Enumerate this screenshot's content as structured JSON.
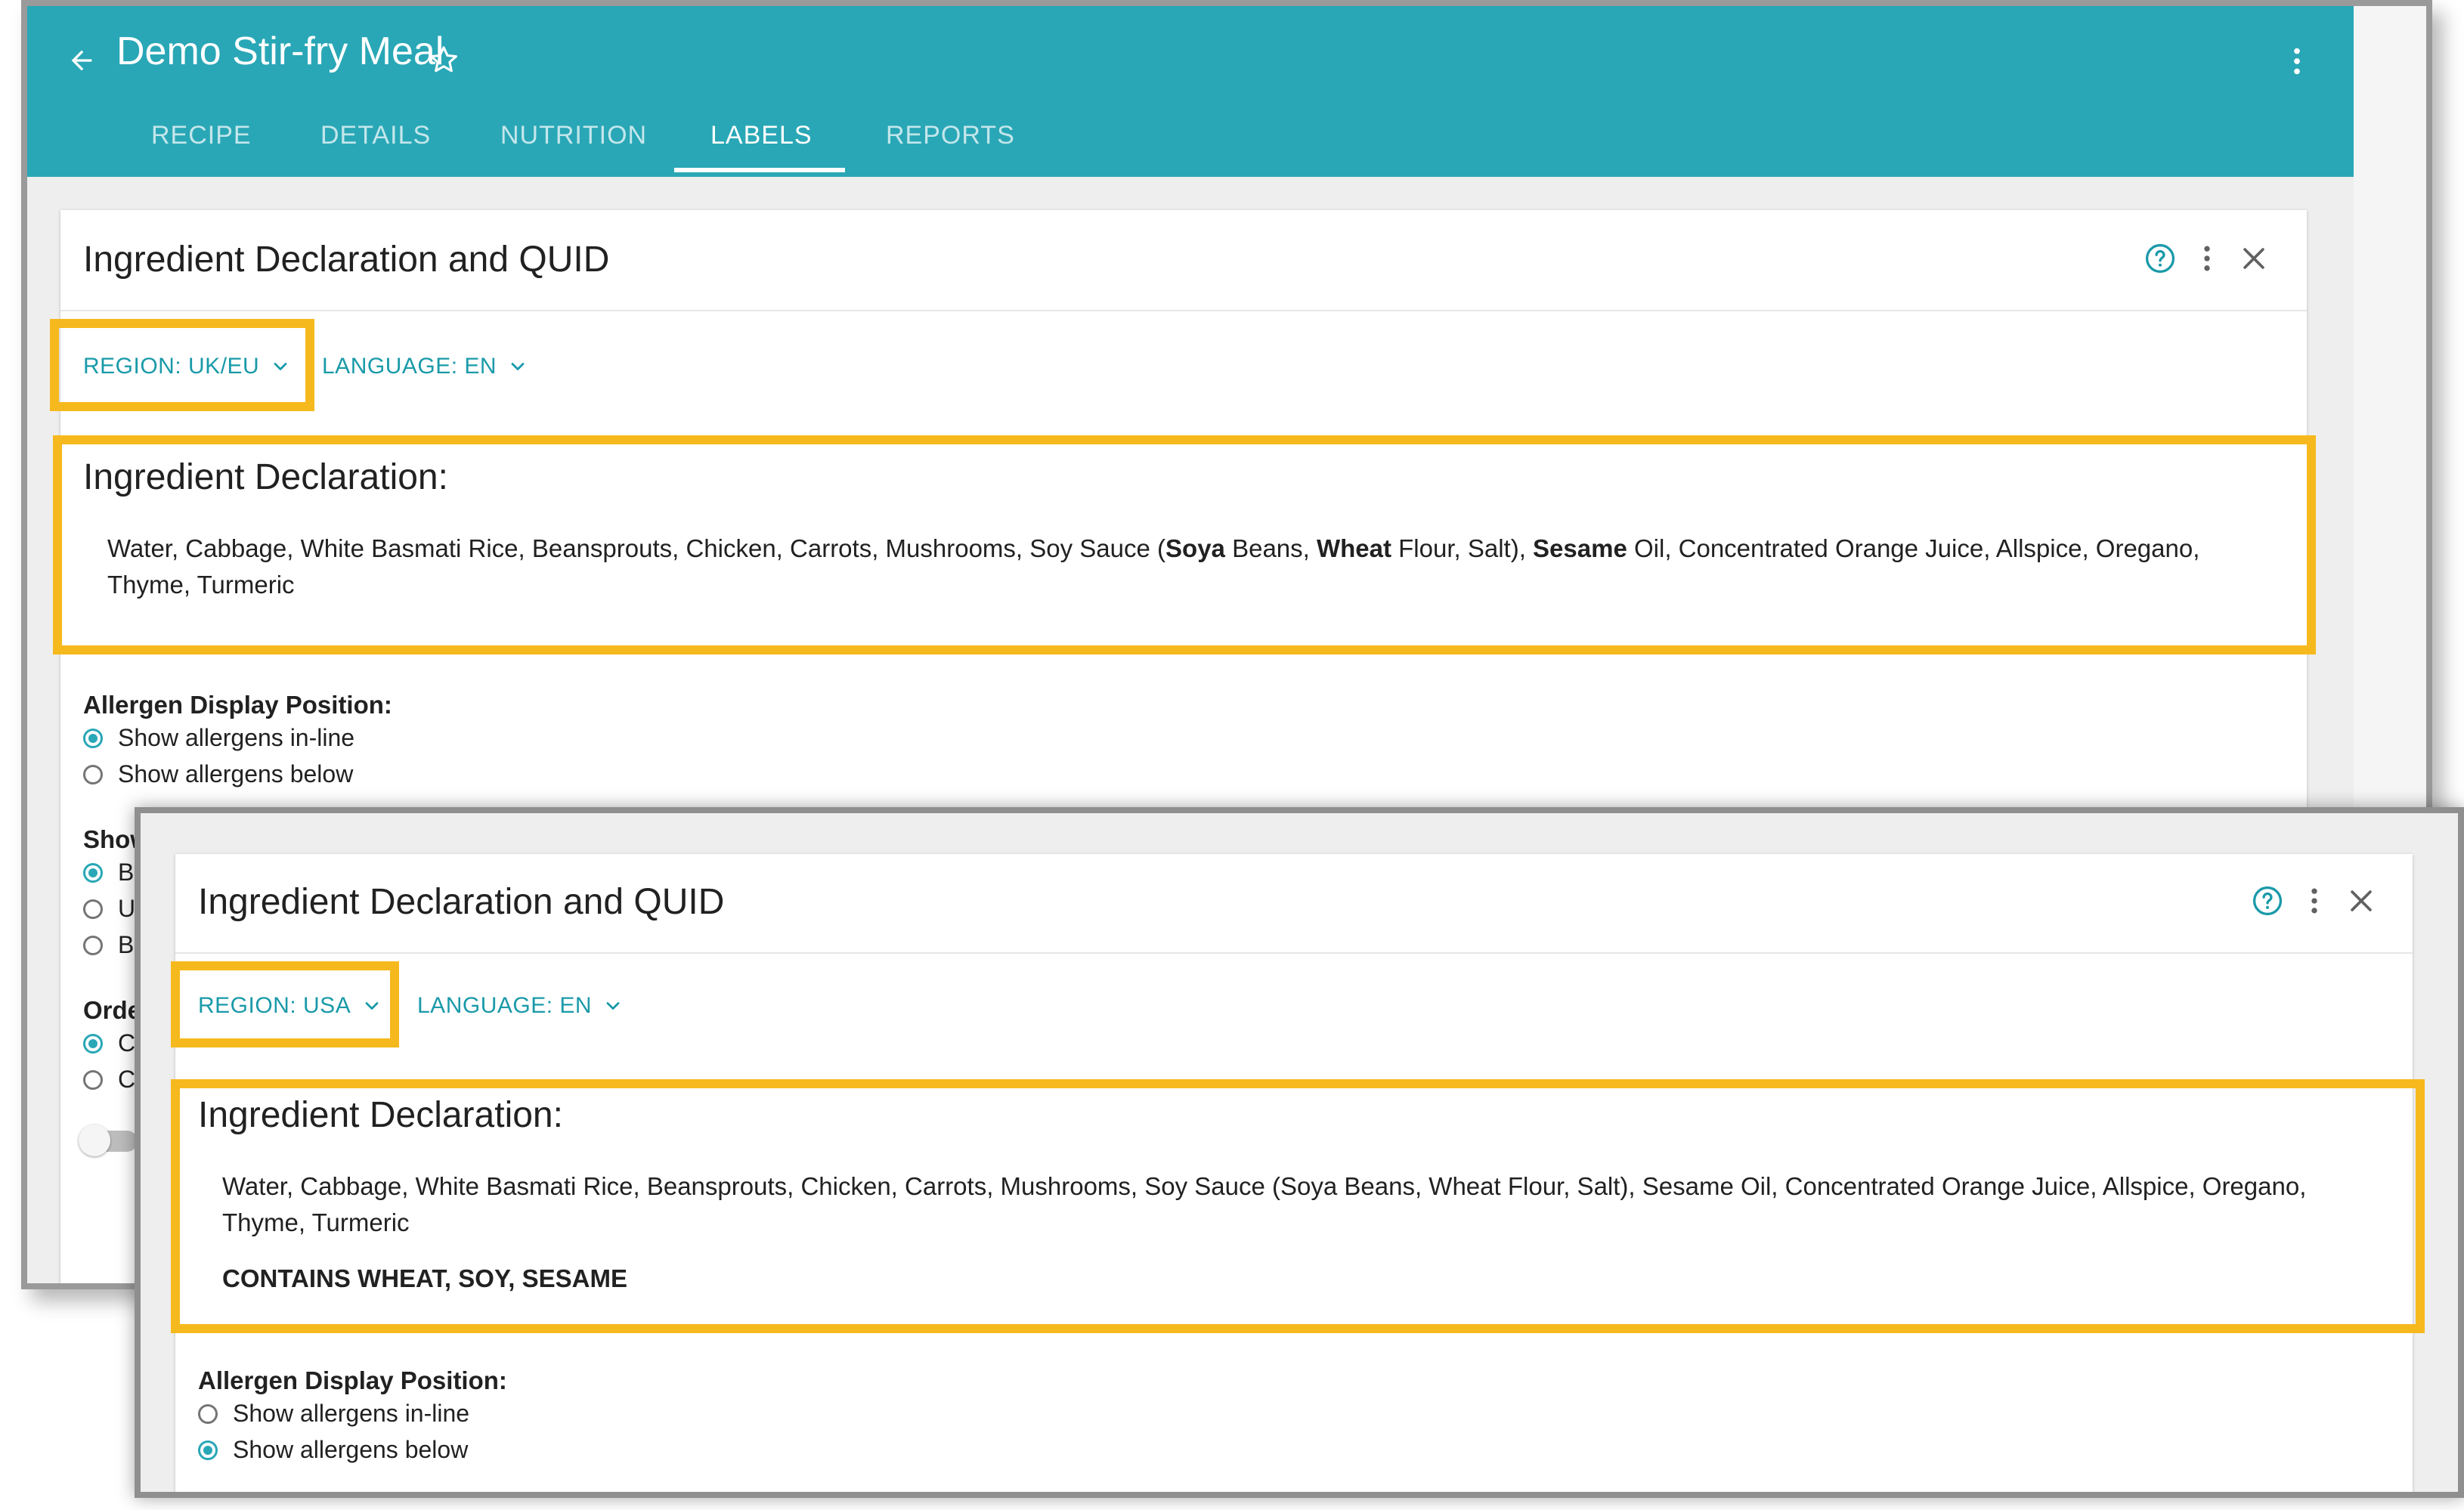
{
  "app": {
    "title": "Demo Stir-fry Meal",
    "tabs": [
      {
        "label": "RECIPE",
        "active": false
      },
      {
        "label": "DETAILS",
        "active": false
      },
      {
        "label": "NUTRITION",
        "active": false
      },
      {
        "label": "LABELS",
        "active": true
      },
      {
        "label": "REPORTS",
        "active": false
      }
    ]
  },
  "panel_top": {
    "title": "Ingredient Declaration and QUID",
    "region_label": "REGION: UK/EU",
    "language_label": "LANGUAGE: EN",
    "declaration_heading": "Ingredient Declaration:",
    "declaration_segments": [
      {
        "text": "Water, Cabbage, White Basmati Rice, Beansprouts, Chicken, Carrots, Mushrooms, Soy Sauce (",
        "bold": false
      },
      {
        "text": "Soya",
        "bold": true
      },
      {
        "text": " Beans, ",
        "bold": false
      },
      {
        "text": "Wheat",
        "bold": true
      },
      {
        "text": " Flour, Salt), ",
        "bold": false
      },
      {
        "text": "Sesame",
        "bold": true
      },
      {
        "text": " Oil, Concentrated Orange Juice, Allspice, Oregano, Thyme, Turmeric",
        "bold": false
      }
    ],
    "allergen_position_heading": "Allergen Display Position:",
    "allergen_options": [
      {
        "label": "Show allergens in-line",
        "selected": true
      },
      {
        "label": "Show allergens below",
        "selected": false
      }
    ],
    "partial_headings": [
      "Show",
      "Orde"
    ],
    "partial_options_1": [
      {
        "letter": "B",
        "selected": true
      },
      {
        "letter": "U",
        "selected": false
      },
      {
        "letter": "B",
        "selected": false
      }
    ],
    "partial_options_2": [
      {
        "letter": "C",
        "selected": true
      },
      {
        "letter": "C",
        "selected": false
      }
    ]
  },
  "panel_bottom": {
    "title": "Ingredient Declaration and QUID",
    "region_label": "REGION: USA",
    "language_label": "LANGUAGE: EN",
    "declaration_heading": "Ingredient Declaration:",
    "declaration_text": "Water, Cabbage, White Basmati Rice, Beansprouts, Chicken, Carrots, Mushrooms, Soy Sauce (Soya Beans, Wheat Flour, Salt), Sesame Oil, Concentrated Orange Juice, Allspice, Oregano, Thyme, Turmeric",
    "contains_text": "CONTAINS WHEAT, SOY, SESAME",
    "allergen_position_heading": "Allergen Display Position:",
    "allergen_options": [
      {
        "label": "Show allergens in-line",
        "selected": false
      },
      {
        "label": "Show allergens below",
        "selected": true
      }
    ]
  },
  "icons": {
    "back": "arrow-left-icon",
    "favorite": "star-outline-icon",
    "menu": "more-vert-icon",
    "help": "help-circle-icon",
    "close": "close-icon",
    "dropdown": "chevron-down-icon"
  },
  "colors": {
    "brand": "#29a7b6",
    "highlight": "#f6b91d",
    "link": "#1a9aa9"
  }
}
